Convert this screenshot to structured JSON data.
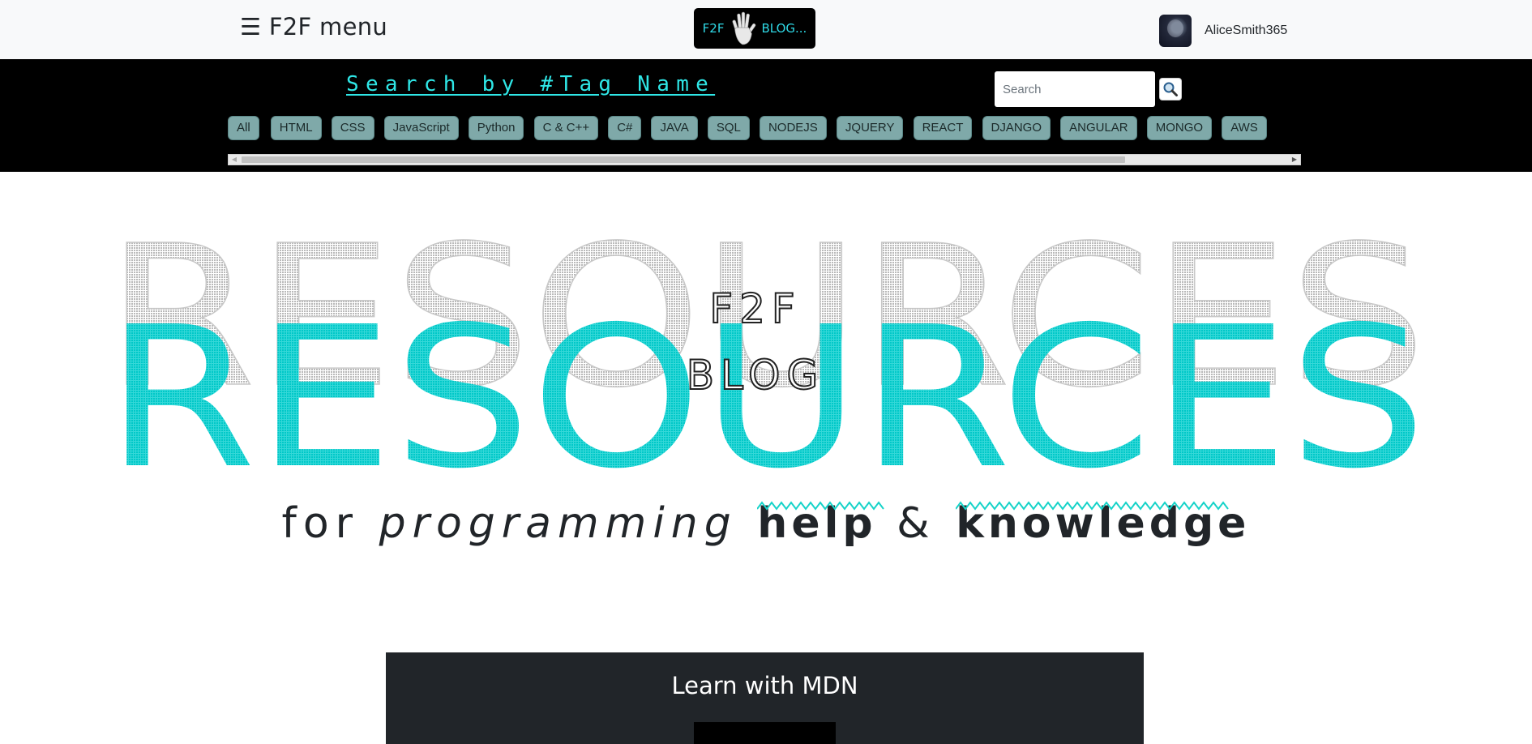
{
  "nav": {
    "menu_label": "☰ F2F menu",
    "brand_left": "F2F",
    "brand_right": "BLOG...",
    "username": "AliceSmith365"
  },
  "tagbar": {
    "title": "Search by #Tag Name",
    "search_placeholder": "Search",
    "tags": [
      "All",
      "HTML",
      "CSS",
      "JavaScript",
      "Python",
      "C & C++",
      "C#",
      "JAVA",
      "SQL",
      "NODEJS",
      "JQUERY",
      "REACT",
      "DJANGO",
      "ANGULAR",
      "MONGO",
      "AWS"
    ]
  },
  "hero": {
    "big_word": "RESOURCES",
    "center_line1": "F2F",
    "center_line2": "BLOG",
    "tagline_plain": "for",
    "tagline_italic": "programming",
    "tagline_bold1": "help",
    "tagline_amp": "&",
    "tagline_bold2": "knowledge"
  },
  "panel": {
    "title": "Learn with MDN"
  },
  "colors": {
    "accent": "#00d0d0",
    "dark": "#212529",
    "tag_bg": "#7fa9a9",
    "outline_text": "#c8c8c8"
  }
}
